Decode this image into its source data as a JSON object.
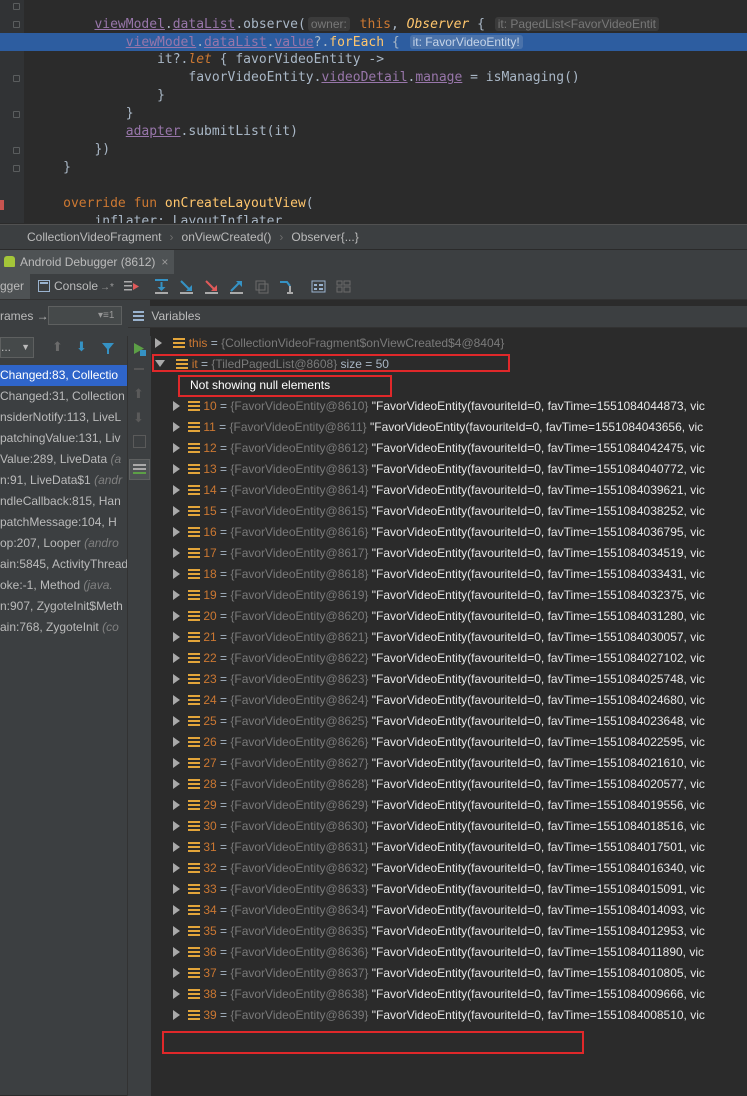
{
  "editor": {
    "lines": [
      {
        "indent": "         ",
        "parts": [
          [
            "ident",
            "viewModel"
          ],
          [
            "plain",
            "."
          ],
          [
            "ident",
            "dataList"
          ],
          [
            "plain",
            ".observe("
          ]
        ],
        "hint": "owner:",
        "after": [
          [
            "kw",
            " this"
          ],
          [
            "plain",
            ", "
          ],
          [
            "italic",
            "Observer"
          ],
          [
            "plain",
            " { "
          ]
        ],
        "hint2": "it: PagedList<FavorVideoEntit"
      },
      {
        "indent": "             ",
        "parts": [
          [
            "ident",
            "viewModel"
          ],
          [
            "plain",
            "."
          ],
          [
            "ident",
            "dataList"
          ],
          [
            "plain",
            "."
          ],
          [
            "ident",
            "value"
          ],
          [
            "plain",
            "?."
          ],
          [
            "fn",
            "forEach"
          ],
          [
            "plain",
            " { "
          ]
        ],
        "hint": "it: FavorVideoEntity!",
        "highlighted": true
      },
      {
        "indent": "                 ",
        "parts": [
          [
            "plain",
            "it?."
          ],
          [
            "let",
            "let"
          ],
          [
            "plain",
            " { favorVideoEntity ->"
          ]
        ]
      },
      {
        "indent": "                     ",
        "parts": [
          [
            "plain",
            "favorVideoEntity."
          ],
          [
            "ident",
            "videoDetail"
          ],
          [
            "plain",
            "."
          ],
          [
            "ident",
            "manage"
          ],
          [
            "plain",
            " = isManaging()"
          ]
        ]
      },
      {
        "indent": "                 ",
        "parts": [
          [
            "plain",
            "}"
          ]
        ]
      },
      {
        "indent": "             ",
        "parts": [
          [
            "plain",
            "}"
          ]
        ]
      },
      {
        "indent": "             ",
        "parts": [
          [
            "ident",
            "adapter"
          ],
          [
            "plain",
            ".submitList(it)"
          ]
        ]
      },
      {
        "indent": "         ",
        "parts": [
          [
            "plain",
            "})"
          ]
        ]
      },
      {
        "indent": "     ",
        "parts": [
          [
            "plain",
            "}"
          ]
        ]
      },
      {
        "indent": "",
        "parts": []
      },
      {
        "indent": "     ",
        "parts": [
          [
            "kw",
            "override fun "
          ],
          [
            "fn",
            "onCreateLayoutView"
          ],
          [
            "plain",
            "("
          ]
        ]
      },
      {
        "indent": "         ",
        "parts": [
          [
            "plain",
            "inflater: LayoutInflater,"
          ]
        ]
      }
    ]
  },
  "breadcrumb": [
    "CollectionVideoFragment",
    "onViewCreated()",
    "Observer{...}"
  ],
  "debugger": {
    "title": "Android Debugger (8612)",
    "close": "×",
    "tabs": {
      "debugger": "gger",
      "console": "Console",
      "console_suffix": "→*"
    }
  },
  "frames": {
    "label": "rames →*",
    "thread_select": "...",
    "rows": [
      {
        "text": "Changed:83, Collectio",
        "selected": true
      },
      {
        "text": "Changed:31, Collection"
      },
      {
        "text": "nsiderNotify:113, LiveL"
      },
      {
        "text": "patchingValue:131, Liv"
      },
      {
        "text": "Value:289, LiveData",
        "pkg": " (a"
      },
      {
        "text": "n:91, LiveData$1",
        "pkg": " (andr"
      },
      {
        "text": "ndleCallback:815, Han"
      },
      {
        "text": "patchMessage:104, H"
      },
      {
        "text": "op:207, Looper",
        "pkg": " (andro"
      },
      {
        "text": "ain:5845, ActivityThread"
      },
      {
        "text": "oke:-1, Method",
        "pkg": " (java."
      },
      {
        "text": "n:907, ZygoteInit$Meth"
      },
      {
        "text": "ain:768, ZygoteInit",
        "pkg": " (co"
      }
    ]
  },
  "variables": {
    "label": "Variables",
    "this_row": {
      "name": "this",
      "eq": " = ",
      "ref": "{CollectionVideoFragment$onViewCreated$4@8404}"
    },
    "it_row": {
      "name": "it",
      "eq": " = ",
      "ref": "{TiledPagedList@8608}",
      "size": "  size = 50"
    },
    "null_note": "Not showing null elements",
    "items": [
      {
        "idx": "10",
        "ref": "{FavorVideoEntity@8610}",
        "val": "\"FavorVideoEntity(favouriteId=0, favTime=1551084044873, vic"
      },
      {
        "idx": "11",
        "ref": "{FavorVideoEntity@8611}",
        "val": "\"FavorVideoEntity(favouriteId=0, favTime=1551084043656, vic"
      },
      {
        "idx": "12",
        "ref": "{FavorVideoEntity@8612}",
        "val": "\"FavorVideoEntity(favouriteId=0, favTime=1551084042475, vic"
      },
      {
        "idx": "13",
        "ref": "{FavorVideoEntity@8613}",
        "val": "\"FavorVideoEntity(favouriteId=0, favTime=1551084040772, vic"
      },
      {
        "idx": "14",
        "ref": "{FavorVideoEntity@8614}",
        "val": "\"FavorVideoEntity(favouriteId=0, favTime=1551084039621, vic"
      },
      {
        "idx": "15",
        "ref": "{FavorVideoEntity@8615}",
        "val": "\"FavorVideoEntity(favouriteId=0, favTime=1551084038252, vic"
      },
      {
        "idx": "16",
        "ref": "{FavorVideoEntity@8616}",
        "val": "\"FavorVideoEntity(favouriteId=0, favTime=1551084036795, vic"
      },
      {
        "idx": "17",
        "ref": "{FavorVideoEntity@8617}",
        "val": "\"FavorVideoEntity(favouriteId=0, favTime=1551084034519, vic"
      },
      {
        "idx": "18",
        "ref": "{FavorVideoEntity@8618}",
        "val": "\"FavorVideoEntity(favouriteId=0, favTime=1551084033431, vic"
      },
      {
        "idx": "19",
        "ref": "{FavorVideoEntity@8619}",
        "val": "\"FavorVideoEntity(favouriteId=0, favTime=1551084032375, vic"
      },
      {
        "idx": "20",
        "ref": "{FavorVideoEntity@8620}",
        "val": "\"FavorVideoEntity(favouriteId=0, favTime=1551084031280, vic"
      },
      {
        "idx": "21",
        "ref": "{FavorVideoEntity@8621}",
        "val": "\"FavorVideoEntity(favouriteId=0, favTime=1551084030057, vic"
      },
      {
        "idx": "22",
        "ref": "{FavorVideoEntity@8622}",
        "val": "\"FavorVideoEntity(favouriteId=0, favTime=1551084027102, vic"
      },
      {
        "idx": "23",
        "ref": "{FavorVideoEntity@8623}",
        "val": "\"FavorVideoEntity(favouriteId=0, favTime=1551084025748, vic"
      },
      {
        "idx": "24",
        "ref": "{FavorVideoEntity@8624}",
        "val": "\"FavorVideoEntity(favouriteId=0, favTime=1551084024680, vic"
      },
      {
        "idx": "25",
        "ref": "{FavorVideoEntity@8625}",
        "val": "\"FavorVideoEntity(favouriteId=0, favTime=1551084023648, vic"
      },
      {
        "idx": "26",
        "ref": "{FavorVideoEntity@8626}",
        "val": "\"FavorVideoEntity(favouriteId=0, favTime=1551084022595, vic"
      },
      {
        "idx": "27",
        "ref": "{FavorVideoEntity@8627}",
        "val": "\"FavorVideoEntity(favouriteId=0, favTime=1551084021610, vic"
      },
      {
        "idx": "28",
        "ref": "{FavorVideoEntity@8628}",
        "val": "\"FavorVideoEntity(favouriteId=0, favTime=1551084020577, vic"
      },
      {
        "idx": "29",
        "ref": "{FavorVideoEntity@8629}",
        "val": "\"FavorVideoEntity(favouriteId=0, favTime=1551084019556, vic"
      },
      {
        "idx": "30",
        "ref": "{FavorVideoEntity@8630}",
        "val": "\"FavorVideoEntity(favouriteId=0, favTime=1551084018516, vic"
      },
      {
        "idx": "31",
        "ref": "{FavorVideoEntity@8631}",
        "val": "\"FavorVideoEntity(favouriteId=0, favTime=1551084017501, vic"
      },
      {
        "idx": "32",
        "ref": "{FavorVideoEntity@8632}",
        "val": "\"FavorVideoEntity(favouriteId=0, favTime=1551084016340, vic"
      },
      {
        "idx": "33",
        "ref": "{FavorVideoEntity@8633}",
        "val": "\"FavorVideoEntity(favouriteId=0, favTime=1551084015091, vic"
      },
      {
        "idx": "34",
        "ref": "{FavorVideoEntity@8634}",
        "val": "\"FavorVideoEntity(favouriteId=0, favTime=1551084014093, vic"
      },
      {
        "idx": "35",
        "ref": "{FavorVideoEntity@8635}",
        "val": "\"FavorVideoEntity(favouriteId=0, favTime=1551084012953, vic"
      },
      {
        "idx": "36",
        "ref": "{FavorVideoEntity@8636}",
        "val": "\"FavorVideoEntity(favouriteId=0, favTime=1551084011890, vic"
      },
      {
        "idx": "37",
        "ref": "{FavorVideoEntity@8637}",
        "val": "\"FavorVideoEntity(favouriteId=0, favTime=1551084010805, vic"
      },
      {
        "idx": "38",
        "ref": "{FavorVideoEntity@8638}",
        "val": "\"FavorVideoEntity(favouriteId=0, favTime=1551084009666, vic"
      },
      {
        "idx": "39",
        "ref": "{FavorVideoEntity@8639}",
        "val": "\"FavorVideoEntity(favouriteId=0, favTime=1551084008510, vic"
      }
    ]
  },
  "icons": {
    "toolbar": [
      "show-execution-point-icon",
      "step-over-icon",
      "step-into-icon",
      "force-step-into-icon",
      "step-out-icon",
      "drop-frame-icon",
      "run-to-cursor-icon",
      "evaluate-icon",
      "restore-layout-icon"
    ]
  },
  "colors": {
    "annotation": "#e0282a",
    "selection": "#2f65ca",
    "field_icon": "#e3a53a"
  }
}
